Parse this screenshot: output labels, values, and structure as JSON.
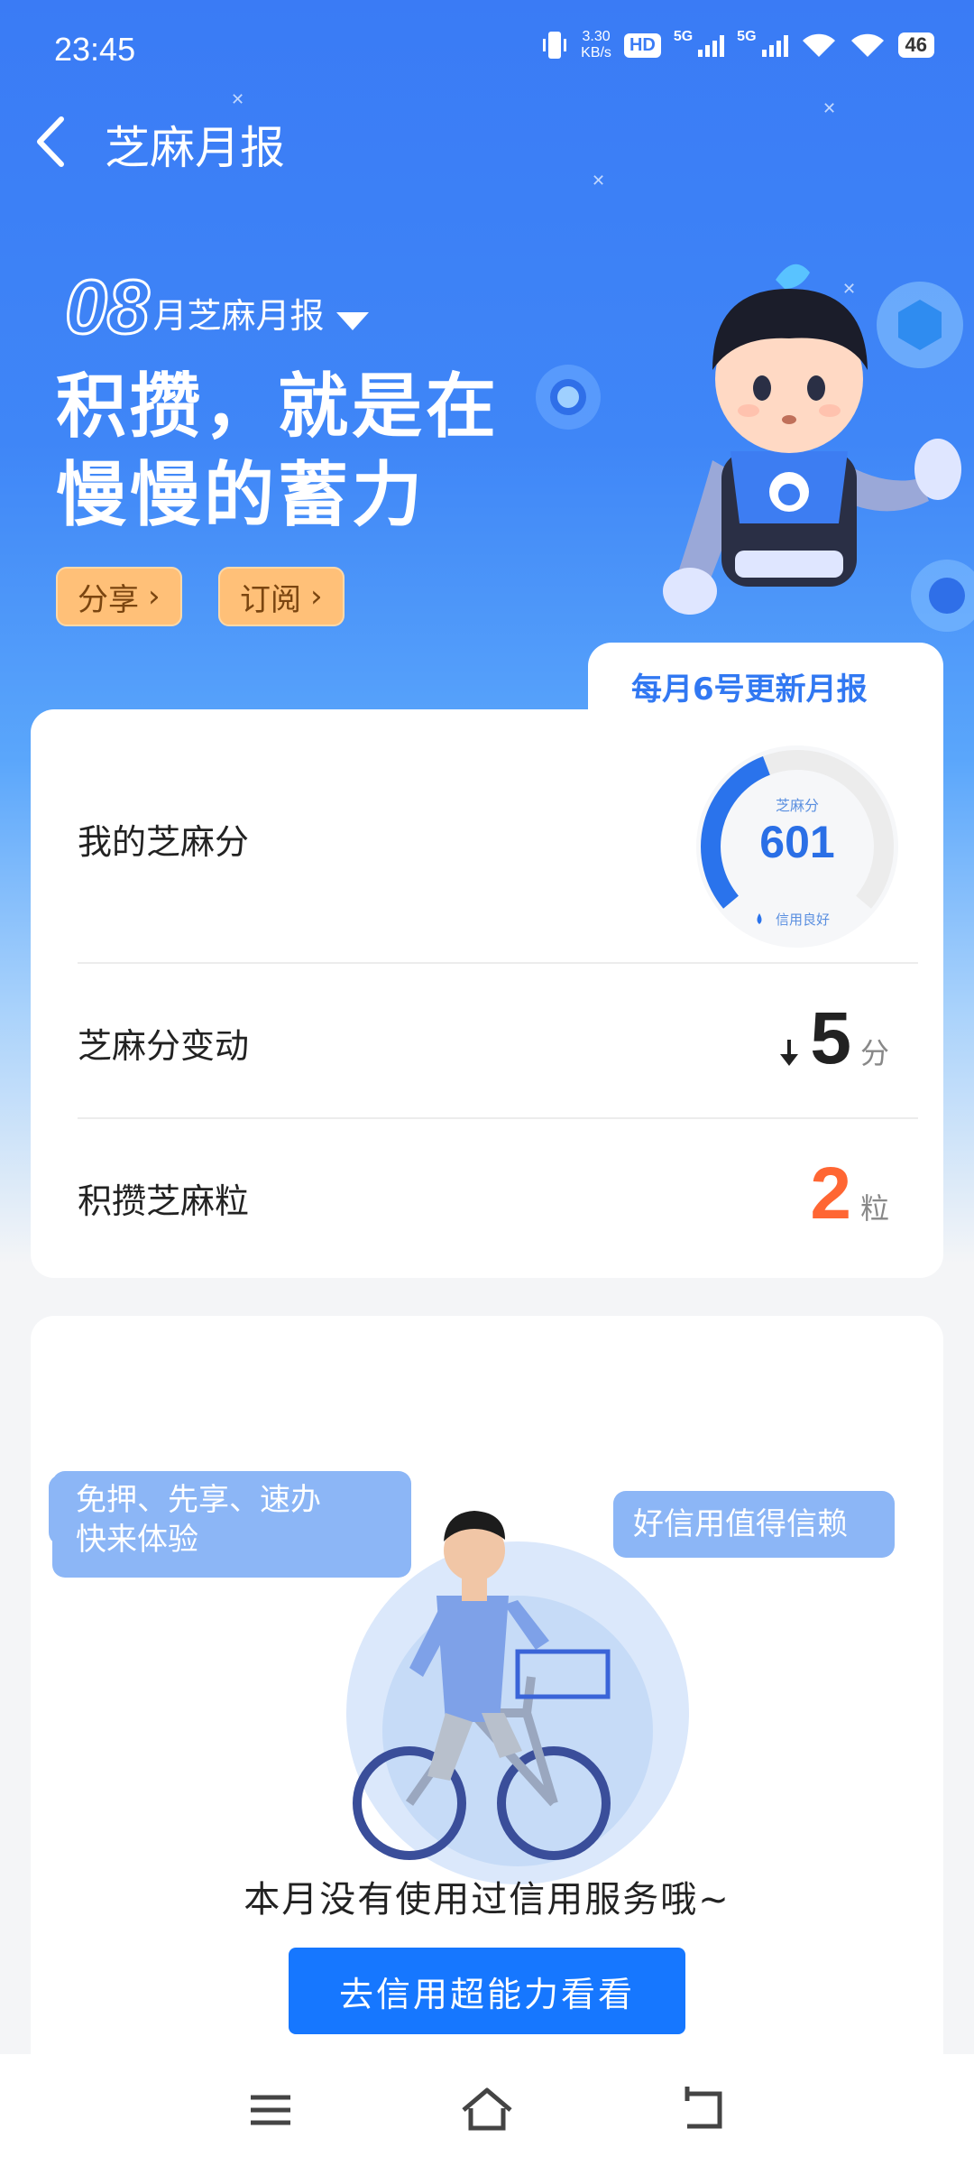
{
  "status_bar": {
    "time": "23:45",
    "net_speed_value": "3.30",
    "net_speed_unit": "KB/s",
    "hd_label": "HD",
    "network_1": "5G",
    "network_2": "5G",
    "battery": "46"
  },
  "header": {
    "title": "芝麻月报"
  },
  "report": {
    "month_number": "08",
    "month_suffix": "月芝麻月报",
    "slogan_line1": "积攒，就是在",
    "slogan_line2": "慢慢的蓄力",
    "share_label": "分享",
    "subscribe_label": "订阅",
    "update_note": "每月6号更新月报"
  },
  "score_card": {
    "score_label": "我的芝麻分",
    "gauge_title": "芝麻分",
    "score_value": "601",
    "score_fraction": 0.42,
    "credit_level": "信用良好",
    "change_label": "芝麻分变动",
    "change_value": "5",
    "change_unit": "分",
    "change_direction": "down",
    "grains_label": "积攒芝麻粒",
    "grains_value": "2",
    "grains_unit": "粒"
  },
  "service_card": {
    "bubble_left_line1": "免押、先享、速办",
    "bubble_left_line2": "快来体验",
    "bubble_right": "好信用值得信赖",
    "empty_text": "本月没有使用过信用服务哦~",
    "cta_label": "去信用超能力看看"
  },
  "colors": {
    "brand_blue": "#1677ff",
    "accent_orange": "#ff6633",
    "pill_orange": "#ffc078"
  },
  "icons": {
    "back": "back-arrow-icon",
    "dropdown": "triangle-down-icon",
    "chevron": "chevron-right-icon",
    "arrow_down": "arrow-down-icon",
    "nav_menu": "menu-icon",
    "nav_home": "home-icon",
    "nav_back": "back-icon"
  }
}
